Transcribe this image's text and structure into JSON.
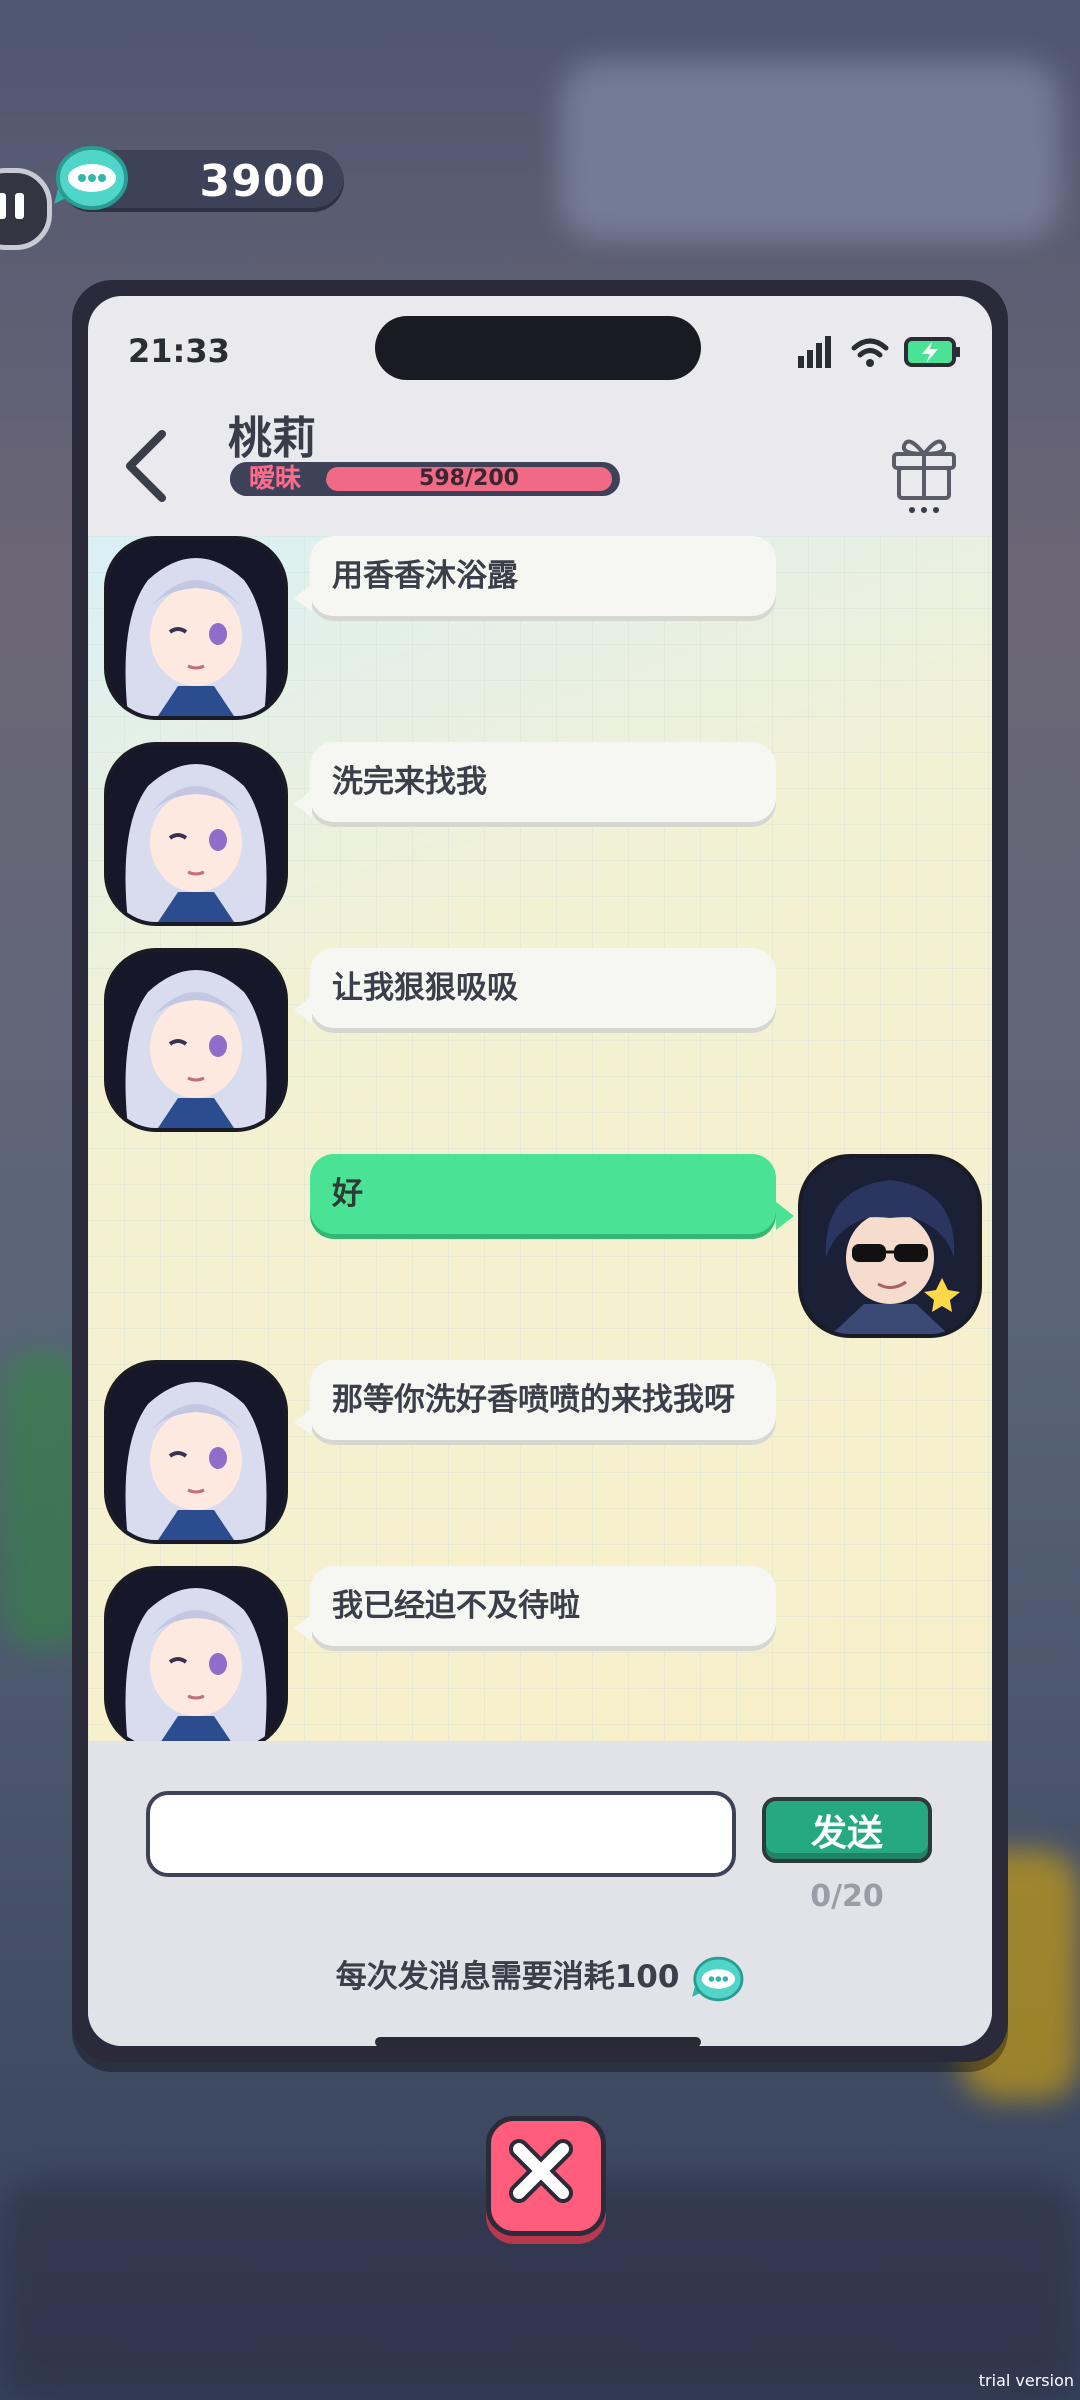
{
  "currency": {
    "value": "3900"
  },
  "status_bar": {
    "time": "21:33"
  },
  "header": {
    "contact_name": "桃莉",
    "relation_label": "暧昧",
    "affinity_value": "598/200"
  },
  "messages": [
    {
      "from": "contact",
      "text": "用香香沐浴露"
    },
    {
      "from": "contact",
      "text": "洗完来找我"
    },
    {
      "from": "contact",
      "text": "让我狠狠吸吸"
    },
    {
      "from": "user",
      "text": "好"
    },
    {
      "from": "contact",
      "text": "那等你洗好香喷喷的来找我呀"
    },
    {
      "from": "contact",
      "text": "我已经迫不及待啦"
    }
  ],
  "composer": {
    "placeholder": "",
    "send_label": "发送",
    "char_count": "0/20",
    "cost_note": "每次发消息需要消耗100"
  },
  "watermark": "trial version",
  "colors": {
    "accent_green": "#4ae395",
    "send_green": "#26a880",
    "affinity_pink": "#f06a85",
    "close_red": "#ff5d7b"
  }
}
